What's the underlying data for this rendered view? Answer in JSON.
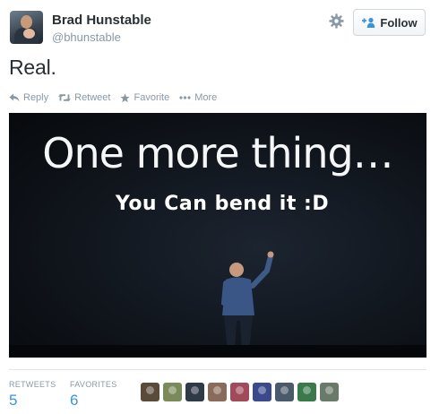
{
  "author": {
    "fullname": "Brad Hunstable",
    "screenname": "@bhunstable"
  },
  "follow_button": {
    "label": "Follow",
    "icon": "add-user-icon"
  },
  "settings": {
    "icon": "gear-icon"
  },
  "tweet": {
    "text": "Real."
  },
  "actions": [
    {
      "label": "Reply",
      "icon": "reply-icon"
    },
    {
      "label": "Retweet",
      "icon": "retweet-icon"
    },
    {
      "label": "Favorite",
      "icon": "star-icon"
    },
    {
      "label": "More",
      "icon": "more-icon"
    }
  ],
  "media": {
    "headline": "One more thing…",
    "caption": "You Can bend it :D"
  },
  "stats": {
    "retweets": {
      "label": "RETWEETS",
      "value": "5"
    },
    "favorites": {
      "label": "FAVORITES",
      "value": "6"
    }
  },
  "favoriters": [
    {
      "color": "#5a4a3a"
    },
    {
      "color": "#7a8a5a"
    },
    {
      "color": "#2f3a47"
    },
    {
      "color": "#8a6a5a"
    },
    {
      "color": "#a04a5a"
    },
    {
      "color": "#3a4a8a"
    },
    {
      "color": "#4a5a6a"
    },
    {
      "color": "#3a7a4a"
    },
    {
      "color": "#6a7a6a"
    }
  ],
  "colors": {
    "link_blue": "#3b94d9",
    "muted_gray": "#8899a6",
    "text": "#292f33"
  }
}
